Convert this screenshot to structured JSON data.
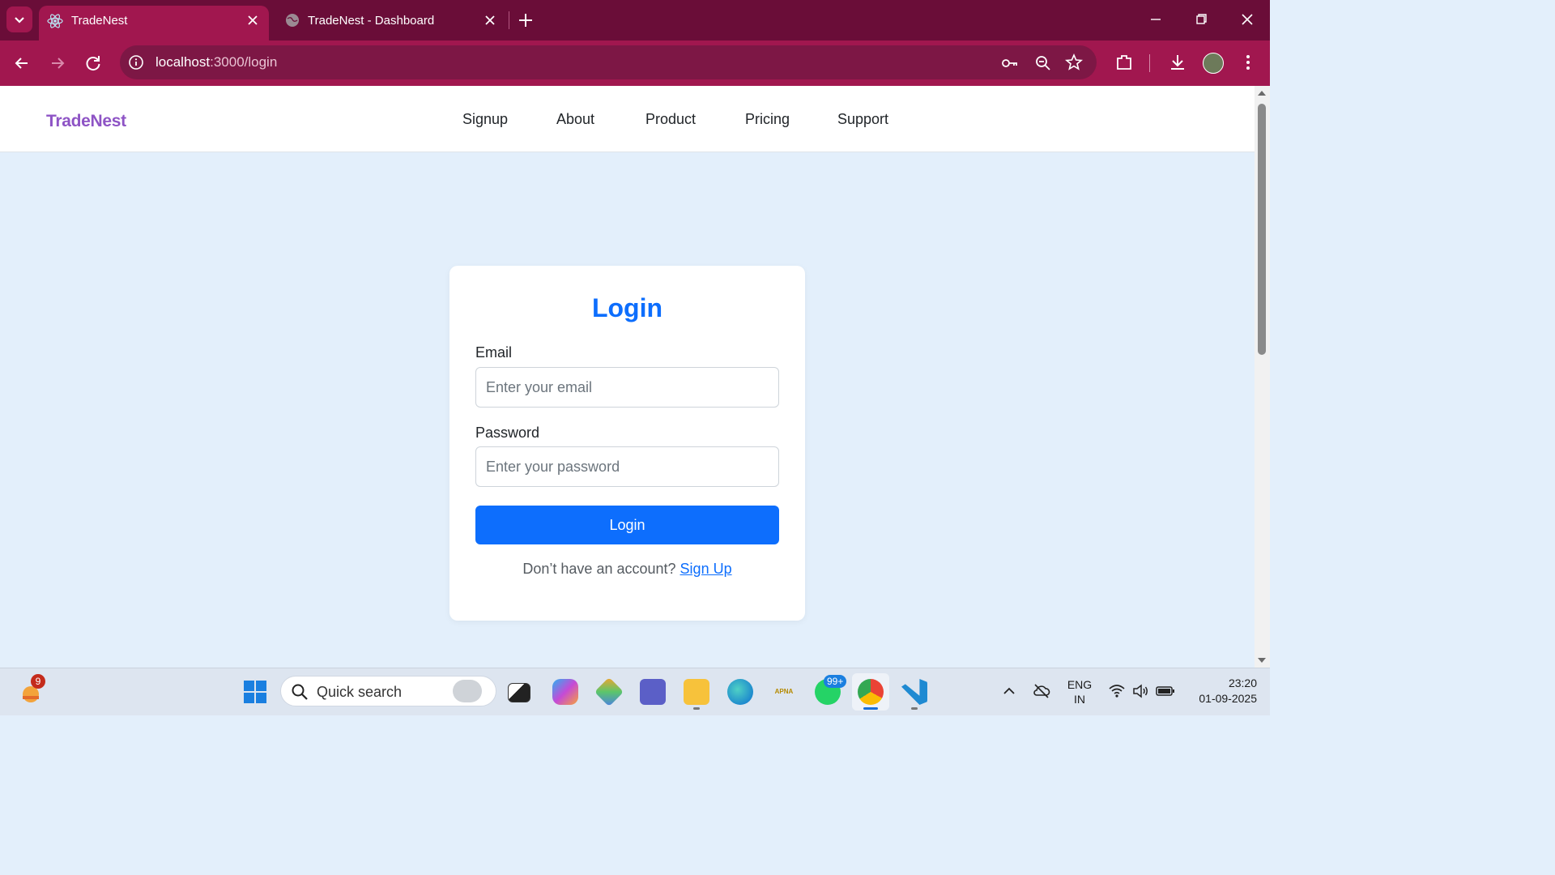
{
  "browser": {
    "tabs": [
      {
        "title": "TradeNest",
        "active": true
      },
      {
        "title": "TradeNest - Dashboard",
        "active": false
      }
    ],
    "url_host": "localhost",
    "url_path": ":3000/login"
  },
  "navbar": {
    "brand": "TradeNest",
    "links": [
      "Signup",
      "About",
      "Product",
      "Pricing",
      "Support"
    ]
  },
  "login": {
    "title": "Login",
    "email_label": "Email",
    "email_placeholder": "Enter your email",
    "password_label": "Password",
    "password_placeholder": "Enter your password",
    "button_label": "Login",
    "prompt_text": "Don’t have an account?",
    "signup_link": "Sign Up"
  },
  "taskbar": {
    "weather_badge": "9",
    "search_label": "Quick search",
    "whatsapp_badge": "99+",
    "language_line1": "ENG",
    "language_line2": "IN",
    "time": "23:20",
    "date": "01-09-2025"
  },
  "colors": {
    "browser_frame": "#6a0d38",
    "browser_toolbar": "#a1174f",
    "brand": "#8e54c5",
    "primary": "#0d6efd",
    "page_background": "#e3effb"
  }
}
